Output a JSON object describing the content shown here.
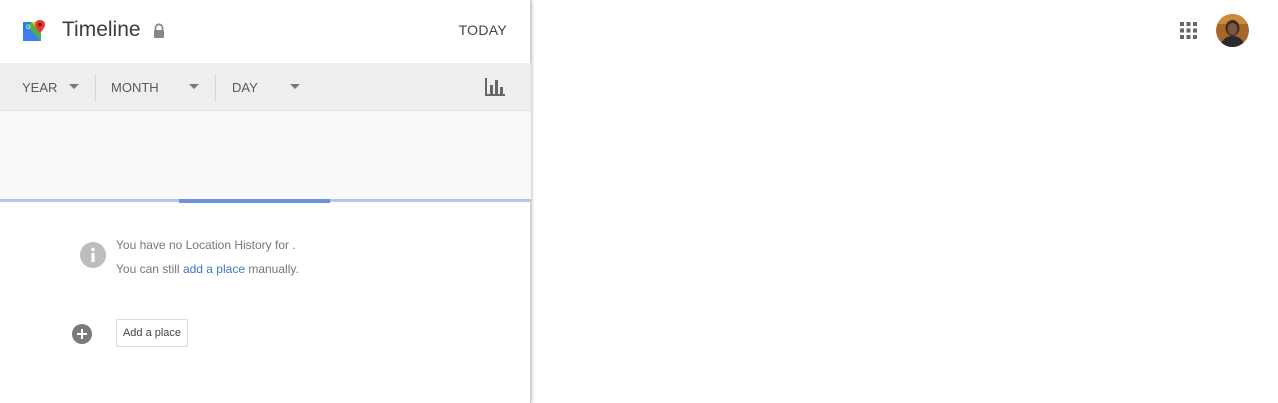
{
  "header": {
    "title": "Timeline",
    "today_label": "TODAY"
  },
  "filters": {
    "year_label": "YEAR",
    "month_label": "MONTH",
    "day_label": "DAY"
  },
  "empty_state": {
    "line1": "You have no Location History for .",
    "line2_prefix": "You can still ",
    "line2_link": "add a place",
    "line2_suffix": " manually."
  },
  "actions": {
    "add_place_label": "Add a place"
  },
  "icons": {
    "logo": "google-maps-icon",
    "lock": "lock-icon",
    "stats": "bar-chart-icon",
    "info": "info-icon",
    "add": "add-circle-icon",
    "apps": "apps-grid-icon"
  },
  "colors": {
    "link": "#3b78c8",
    "filterbar_bg": "#eeeeee",
    "timeline_highlight": "#6d8fdc"
  }
}
